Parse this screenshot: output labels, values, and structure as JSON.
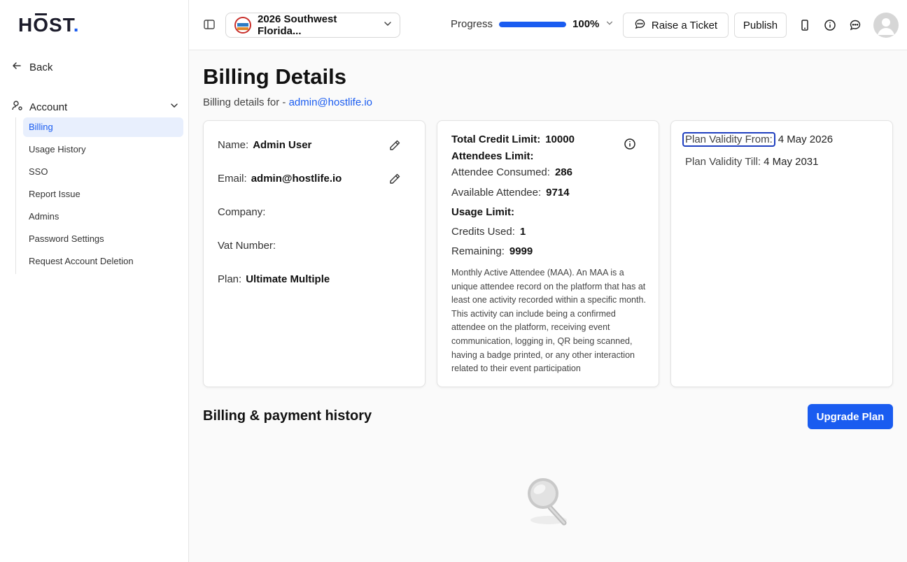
{
  "brand": {
    "logo_text_h": "H",
    "logo_text_o": "O",
    "logo_text_st": "ST",
    "logo_dot": ".",
    "accent": "#1a5cf0"
  },
  "sidebar": {
    "back_label": "Back",
    "section_label": "Account",
    "items": [
      {
        "label": "Billing",
        "active": true
      },
      {
        "label": "Usage History",
        "active": false
      },
      {
        "label": "SSO",
        "active": false
      },
      {
        "label": "Report Issue",
        "active": false
      },
      {
        "label": "Admins",
        "active": false
      },
      {
        "label": "Password Settings",
        "active": false
      },
      {
        "label": "Request Account Deletion",
        "active": false
      }
    ]
  },
  "topbar": {
    "event_name": "2026 Southwest Florida...",
    "progress_label": "Progress",
    "progress_value": 100,
    "progress_text": "100%",
    "raise_ticket_label": "Raise a Ticket",
    "publish_label": "Publish",
    "icons": [
      "sidebar-toggle-icon",
      "mobile-icon",
      "info-icon",
      "chat-icon",
      "user-avatar-icon"
    ]
  },
  "page": {
    "title": "Billing Details",
    "subtitle_prefix": "Billing details for - ",
    "subtitle_email": "admin@hostlife.io"
  },
  "profile_card": {
    "name_label": "Name:",
    "name_value": "Admin User",
    "email_label": "Email:",
    "email_value": "admin@hostlife.io",
    "company_label": "Company:",
    "company_value": "",
    "vat_label": "Vat Number:",
    "vat_value": "",
    "plan_label": "Plan:",
    "plan_value": "Ultimate Multiple"
  },
  "credits_card": {
    "total_label": "Total Credit Limit:",
    "total_value": "10000",
    "attendees_limit_label": "Attendees Limit:",
    "consumed_label": "Attendee Consumed:",
    "consumed_value": "286",
    "available_label": "Available Attendee:",
    "available_value": "9714",
    "usage_limit_label": "Usage Limit:",
    "credits_used_label": "Credits Used:",
    "credits_used_value": "1",
    "remaining_label": "Remaining:",
    "remaining_value": "9999",
    "maa_note": "Monthly Active Attendee (MAA). An MAA is a unique attendee record on the platform that has at least one activity recorded within a specific month. This activity can include being a confirmed attendee on the platform, receiving event communication, logging in, QR being scanned, having a badge printed, or any other interaction related to their event participation"
  },
  "validity_card": {
    "from_label": "Plan Validity From:",
    "from_value": "4 May 2026",
    "till_label": "Plan Validity Till:",
    "till_value": "4 May 2031"
  },
  "history": {
    "title": "Billing & payment history",
    "upgrade_label": "Upgrade Plan"
  }
}
